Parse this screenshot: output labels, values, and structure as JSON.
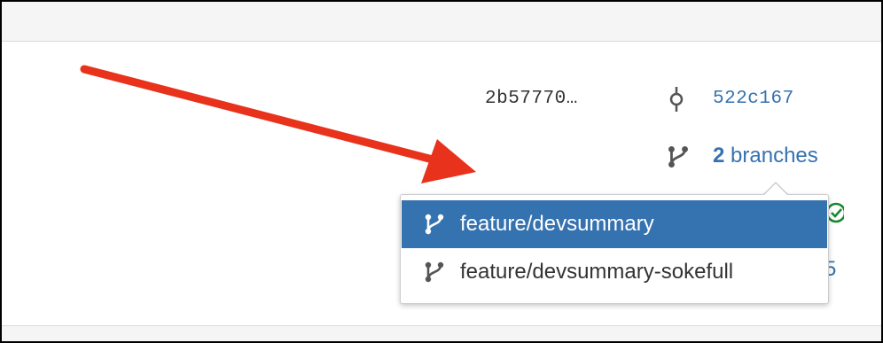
{
  "commit": {
    "hash_short": "2b57770…",
    "commit_icon": "git-commit-icon",
    "commit_link": "522c167"
  },
  "branches": {
    "branch_icon": "git-branch-icon",
    "count": "2",
    "label": "branches"
  },
  "status": {
    "icon": "check-circle-icon",
    "color": "#14892c"
  },
  "behind_text": "5",
  "dropdown": {
    "items": [
      {
        "label": "feature/devsummary",
        "icon": "git-branch-icon",
        "selected": true
      },
      {
        "label": "feature/devsummary-sokefull",
        "icon": "git-branch-icon",
        "selected": false
      }
    ]
  },
  "annotation": {
    "arrow_icon": "red-pointer-arrow",
    "color": "#e8321c"
  },
  "colors": {
    "link": "#3572b0",
    "selected_bg": "#3572b0",
    "panel_bg": "#f5f5f5"
  }
}
